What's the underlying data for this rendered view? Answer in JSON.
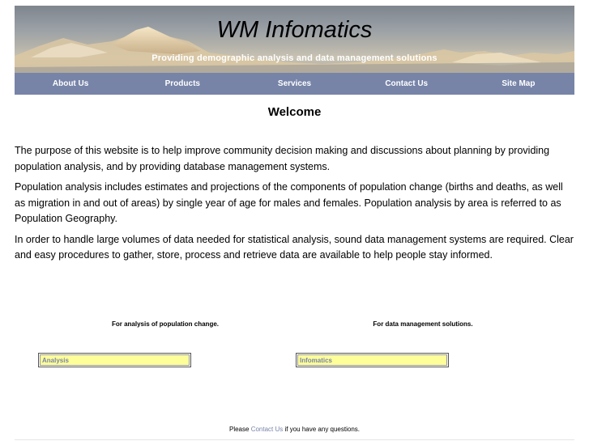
{
  "header": {
    "title": "WM Infomatics",
    "tagline": "Providing demographic analysis and data management solutions"
  },
  "nav": [
    {
      "label": "About Us"
    },
    {
      "label": "Products"
    },
    {
      "label": "Services"
    },
    {
      "label": "Contact Us"
    },
    {
      "label": "Site Map"
    }
  ],
  "main": {
    "heading": "Welcome",
    "paragraphs": [
      "The purpose of this website is to help improve community decision making and discussions about planning by providing population analysis, and by providing database management systems.",
      "Population analysis includes estimates and projections of the components of population change (births and deaths, as well as migration in and out of areas) by single year of age for males and females. Population analysis by area is referred to as Population Geography.",
      "In order to handle large volumes of data needed for statistical analysis, sound data management systems are required. Clear and easy procedures to gather, store, process and retrieve data are available to help people stay informed."
    ]
  },
  "promos": [
    {
      "caption": "For analysis of population change.",
      "link_label": "Analysis"
    },
    {
      "caption": "For data management solutions.",
      "link_label": "Infomatics"
    }
  ],
  "footer": {
    "prefix": "Please",
    "link": "Contact Us",
    "suffix": "if you have any questions."
  },
  "colors": {
    "nav_background": "#7784a8",
    "link": "#7784a8",
    "promo_box_fill": "#ffff99"
  },
  "icons": {
    "header_image": "mountain-range-banner"
  }
}
